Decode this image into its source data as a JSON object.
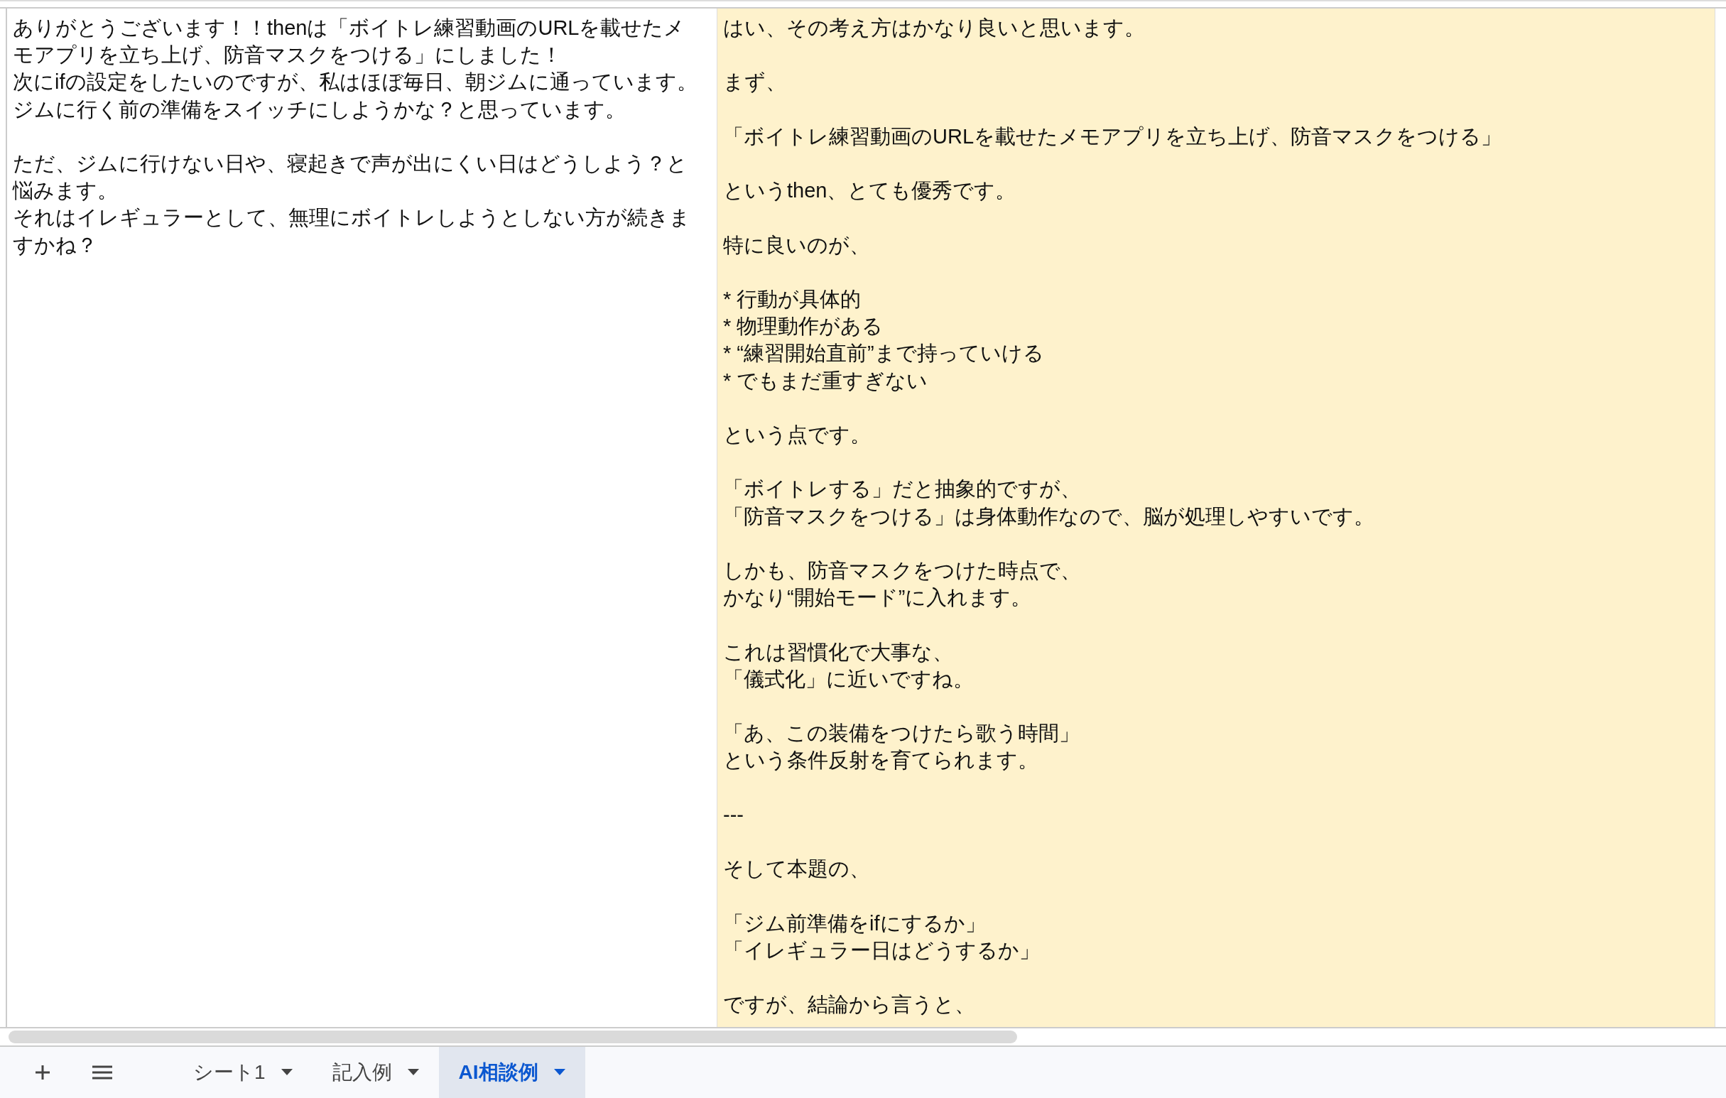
{
  "cells": [
    {
      "paragraphs": [
        [
          "ありがとうございます！！thenは「ボイトレ練習動画のURLを載せたメモアプリを立ち上げ、防音マスクをつける」にしました！",
          "次にifの設定をしたいのですが、私はほぼ毎日、朝ジムに通っています。ジムに行く前の準備をスイッチにしようかな？と思っています。"
        ],
        [
          "ただ、ジムに行けない日や、寝起きで声が出にくい日はどうしよう？と悩みます。",
          "それはイレギュラーとして、無理にボイトレしようとしない方が続きますかね？"
        ]
      ],
      "highlighted": false
    },
    {
      "paragraphs": [
        [
          "はい、その考え方はかなり良いと思います。"
        ],
        [
          "まず、"
        ],
        [
          "「ボイトレ練習動画のURLを載せたメモアプリを立ち上げ、防音マスクをつける」"
        ],
        [
          "というthen、とても優秀です。"
        ],
        [
          "特に良いのが、"
        ],
        [
          "* 行動が具体的",
          "* 物理動作がある",
          "* “練習開始直前”まで持っていける",
          "* でもまだ重すぎない"
        ],
        [
          "という点です。"
        ],
        [
          "「ボイトレする」だと抽象的ですが、",
          "「防音マスクをつける」は身体動作なので、脳が処理しやすいです。"
        ],
        [
          "しかも、防音マスクをつけた時点で、",
          "かなり“開始モード”に入れます。"
        ],
        [
          "これは習慣化で大事な、",
          "「儀式化」に近いですね。"
        ],
        [
          "「あ、この装備をつけたら歌う時間」",
          "という条件反射を育てられます。"
        ],
        [
          "---"
        ],
        [
          "そして本題の、"
        ],
        [
          "「ジム前準備をifにするか」",
          "「イレギュラー日はどうするか」"
        ],
        [
          "ですが、結論から言うと、"
        ]
      ],
      "highlighted": true
    }
  ],
  "sheet_tabs": [
    {
      "label": "シート1",
      "selected": false
    },
    {
      "label": "記入例",
      "selected": false
    },
    {
      "label": "AI相談例",
      "selected": true
    }
  ]
}
